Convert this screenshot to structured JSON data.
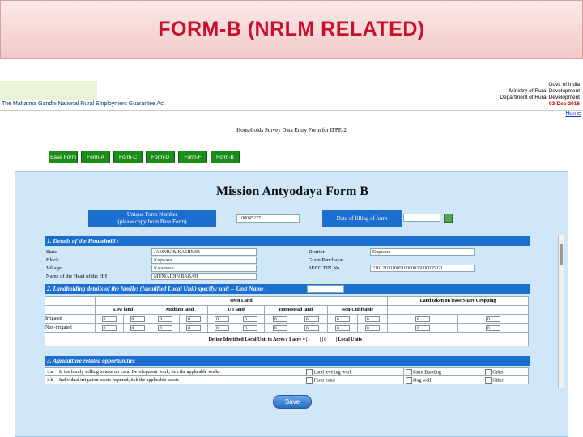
{
  "banner": {
    "title": "FORM-B (NRLM RELATED)"
  },
  "header": {
    "act_name": "The Mahatma Gandhi National Rural Employment Guarantee Act",
    "gov_lines": [
      "Govt. of India",
      "Ministry of Rural Development",
      "Department of Rural Development"
    ],
    "date": "03-Dec-2016",
    "home_link": "Home"
  },
  "survey_title": "Households Survey Data Entry Form for IPPE-2",
  "tabs": [
    "Base Form",
    "Form-A",
    "Form-C",
    "Form-D",
    "Form-F",
    "Form-B"
  ],
  "form": {
    "title": "Mission Antyodaya Form B",
    "unique_label_1": "Unique Form Number",
    "unique_label_2": "(please copy from Base Form)",
    "unique_value": "100045227",
    "date_label": "Date of filling of form",
    "date_value": ""
  },
  "section1": {
    "title": "1.  Details of the Household :",
    "state_label": "State",
    "state_value": "JAMMU & KASHMIR",
    "district_label": "District",
    "district_value": "Kupwara",
    "block_label": "Block",
    "block_value": "Kupwara",
    "gp_label": "Gram Panchayat",
    "gp_value": "",
    "village_label": "Village",
    "village_value": "Kalaroosh",
    "secc_label": "SECC TIN No.",
    "secc_value": "21012100100510000035000035021",
    "head_label": "Name of the Head of the HH",
    "head_value": "MUMAIDIN BABAH"
  },
  "section2": {
    "title": "2.  Landholding details of the family: (Identified Local Unit) specify: unit -- Unit Name :",
    "own_land": "Own Land",
    "lease_land": "Land taken on lease/Share Cropping",
    "columns": [
      "Low land",
      "Medium land",
      "Up land",
      "Homestead land",
      "Non-Cultivable"
    ],
    "rows": [
      {
        "label": "Irrigated",
        "cells": [
          "0",
          "0",
          "0",
          "0",
          "0",
          "0",
          "0",
          "0",
          "0",
          "0"
        ],
        "lease": [
          "0",
          "0"
        ]
      },
      {
        "label": "Non-irrigated",
        "cells": [
          "0",
          "0",
          "0",
          "0",
          "0",
          "0",
          "0",
          "0",
          "0",
          "0"
        ],
        "lease": [
          "0",
          "0"
        ]
      }
    ],
    "define_label": "Define Identified Local Unit in Acres ( 1 acre =",
    "define_v1": "1",
    "define_v2": "0",
    "define_suffix": "Local Units )"
  },
  "section3": {
    "title": "3.  Agriculture related opportunities",
    "rows": [
      {
        "no": "3.a",
        "text": "Is the family willing to take up Land Development work, tick the applicable works",
        "o1": "Land leveling work",
        "o2": "Farm Bunding",
        "o3": "Other"
      },
      {
        "no": "3.b",
        "text": "Individual irrigation assets required, tick the applicable assets",
        "o1": "Farm pond",
        "o2": "Dug well",
        "o3": "Other"
      }
    ]
  },
  "save_label": "Save"
}
